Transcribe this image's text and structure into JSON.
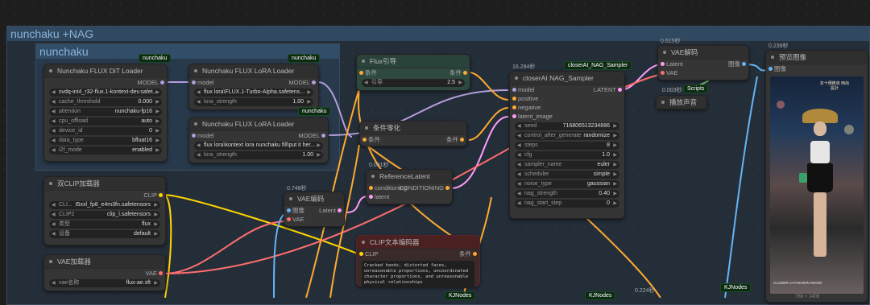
{
  "group_outer": {
    "title": "nunchaku +NAG"
  },
  "group_inner": {
    "title": "nunchaku"
  },
  "badges": {
    "dit": "nunchaku",
    "lora1": "nunchaku",
    "lora2": "nunchaku",
    "sampler": "closerAI_NAG_Sampler",
    "scripts": "Scripts",
    "kj1": "KJNodes",
    "kj2": "KJNodes",
    "kj3": "KJNodes"
  },
  "times": {
    "sampler": "16.294秒",
    "vae_decode": "0.615秒",
    "sound": "0.003秒",
    "preview": "0.239秒",
    "reflatent": "0.001秒",
    "vae_encode": "0.748秒",
    "bottom": "0.224秒"
  },
  "dit": {
    "title": "Nunchaku FLUX DiT Loader",
    "out": "MODEL",
    "widgets": [
      [
        "",
        "svdq-int4_r32-flux.1-kontext-dev.safet..."
      ],
      [
        "cache_threshold",
        "0.000"
      ],
      [
        "attention",
        "nunchaku-fp16"
      ],
      [
        "cpu_offload",
        "auto"
      ],
      [
        "device_id",
        "0"
      ],
      [
        "data_type",
        "bfloat16"
      ],
      [
        "i2f_mode",
        "enabled"
      ]
    ]
  },
  "lora1": {
    "title": "Nunchaku FLUX LoRA Loader",
    "in": "model",
    "out": "MODEL",
    "widgets": [
      [
        "",
        "flux lora\\FLUX.1-Turbo-Alpha.safetens..."
      ],
      [
        "lora_strength",
        "1.00"
      ]
    ]
  },
  "lora2": {
    "title": "Nunchaku FLUX LoRA Loader",
    "in": "model",
    "out": "MODEL",
    "widgets": [
      [
        "",
        "flux lora\\kontext lora nunchaku fill\\put it her..."
      ],
      [
        "lora_strength",
        "1.00"
      ]
    ]
  },
  "flux": {
    "title": "Flux引导",
    "in": "条件",
    "out": "条件",
    "widget": [
      "引导",
      "2.5"
    ]
  },
  "zero": {
    "title": "条件零化",
    "in": "条件",
    "out": "条件"
  },
  "reflatent": {
    "title": "ReferenceLatent",
    "in1": "conditioning",
    "out": "CONDITIONING",
    "in2": "latent"
  },
  "clip2": {
    "title": "双CLIP加载器",
    "out": "CLIP",
    "widgets": [
      [
        "CLI...",
        "t5xxl_fp8_e4m3fn.safetensors"
      ],
      [
        "CLIP2",
        "clip_l.safetensors"
      ],
      [
        "类型",
        "flux"
      ],
      [
        "设备",
        "default"
      ]
    ]
  },
  "vaeload": {
    "title": "VAE加载器",
    "out": "VAE",
    "widget": [
      "vae名称",
      "flux-ae.sft"
    ]
  },
  "vaeenc": {
    "title": "VAE编码",
    "in1": "图像",
    "in2": "VAE",
    "out": "Latent"
  },
  "cliptext": {
    "title": "CLIP文本编码器",
    "in": "CLIP",
    "out": "条件",
    "text": "Cracked hands, distorted faces, unreasonable proportions, uncoordinated character proportions, and unreasonable physical relationships"
  },
  "sampler": {
    "title": "closerAI NAG_Sampler",
    "out": "LATENT",
    "inputs": [
      "model",
      "positive",
      "negative",
      "latent_image"
    ],
    "widgets": [
      [
        "seed",
        "716806513234886"
      ],
      [
        "control_after_generate",
        "randomize"
      ],
      [
        "steps",
        "8"
      ],
      [
        "cfg",
        "1.0"
      ],
      [
        "sampler_name",
        "euler"
      ],
      [
        "scheduler",
        "simple"
      ],
      [
        "noise_type",
        "gaussian"
      ],
      [
        "nag_strength",
        "0.40"
      ],
      [
        "nag_start_step",
        "0"
      ]
    ]
  },
  "vaedec": {
    "title": "VAE解码",
    "in1": "Latent",
    "in2": "VAE",
    "out": "图像"
  },
  "sound": {
    "title": "播放声音"
  },
  "preview": {
    "title": "预览图像",
    "in": "图像",
    "caption": "CLOSER AI FASHION SHOW",
    "sign": "衣十傳統來 時尚設計",
    "dims": "768 × 1408"
  },
  "colors": {
    "model": "#b39ddb",
    "cond": "#ffa931",
    "clip": "#ffd500",
    "vae": "#ff6e6e",
    "latent": "#ff9cf9",
    "image": "#64b5f6"
  }
}
